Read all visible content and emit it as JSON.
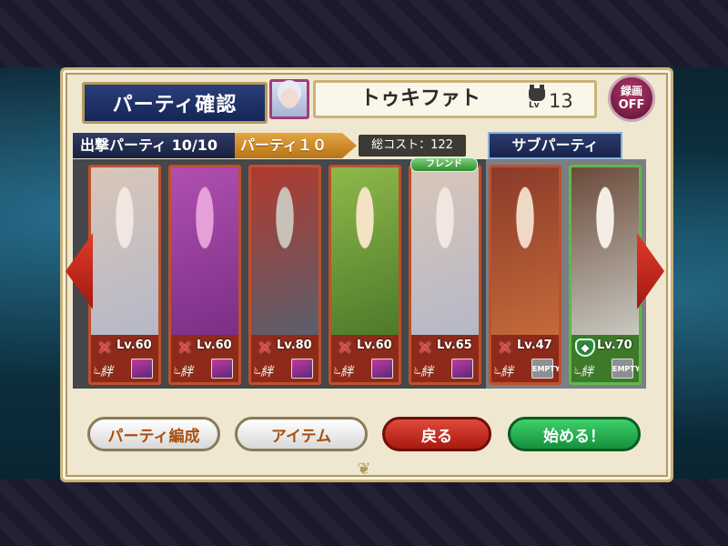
{
  "header": {
    "title": "パーティ確認",
    "player_name": "トゥキファト",
    "level_label": "Lv",
    "level": "13",
    "record_label": "録画",
    "record_state": "OFF"
  },
  "tabs": {
    "sortie": "出撃パーティ 10/10",
    "party": "パーティ１０",
    "cost": "総コスト：122",
    "sub": "サブパーティ"
  },
  "friend_tag": "フレンド",
  "cards": [
    {
      "level": "Lv.60",
      "type": "cross-swords-icon",
      "kizuna": "絆",
      "friend": "portrait",
      "colors": [
        "#d9c6b8",
        "#b5b8c8",
        "#f2e6e0"
      ]
    },
    {
      "level": "Lv.60",
      "type": "cross-swords-icon",
      "kizuna": "絆",
      "friend": "portrait",
      "colors": [
        "#b04fb0",
        "#7a2f86",
        "#e6a0d8"
      ]
    },
    {
      "level": "Lv.80",
      "type": "cross-swords-icon",
      "kizuna": "絆",
      "friend": "portrait",
      "colors": [
        "#b03a2e",
        "#5a5f6e",
        "#c9c1b8"
      ]
    },
    {
      "level": "Lv.60",
      "type": "cross-swords-icon",
      "kizuna": "絆",
      "friend": "portrait",
      "colors": [
        "#8fb84a",
        "#4c7a2a",
        "#f3e3c4"
      ]
    },
    {
      "level": "Lv.65",
      "type": "cross-swords-icon",
      "kizuna": "絆",
      "friend": "portrait",
      "colors": [
        "#d9c6b8",
        "#b5b8c8",
        "#f2e6e0"
      ]
    },
    {
      "level": "Lv.47",
      "type": "cross-swords-icon",
      "kizuna": "絆",
      "friend": "EMPTY",
      "colors": [
        "#8a3a2a",
        "#c46a3a",
        "#efd8c6"
      ]
    },
    {
      "level": "Lv.70",
      "type": "shield-icon",
      "kizuna": "絆",
      "friend": "EMPTY",
      "colors": [
        "#6a4a3a",
        "#c9c8c0",
        "#f3ede6"
      ]
    }
  ],
  "buttons": {
    "edit": "パーティ編成",
    "item": "アイテム",
    "back": "戻る",
    "start": "始める！"
  }
}
